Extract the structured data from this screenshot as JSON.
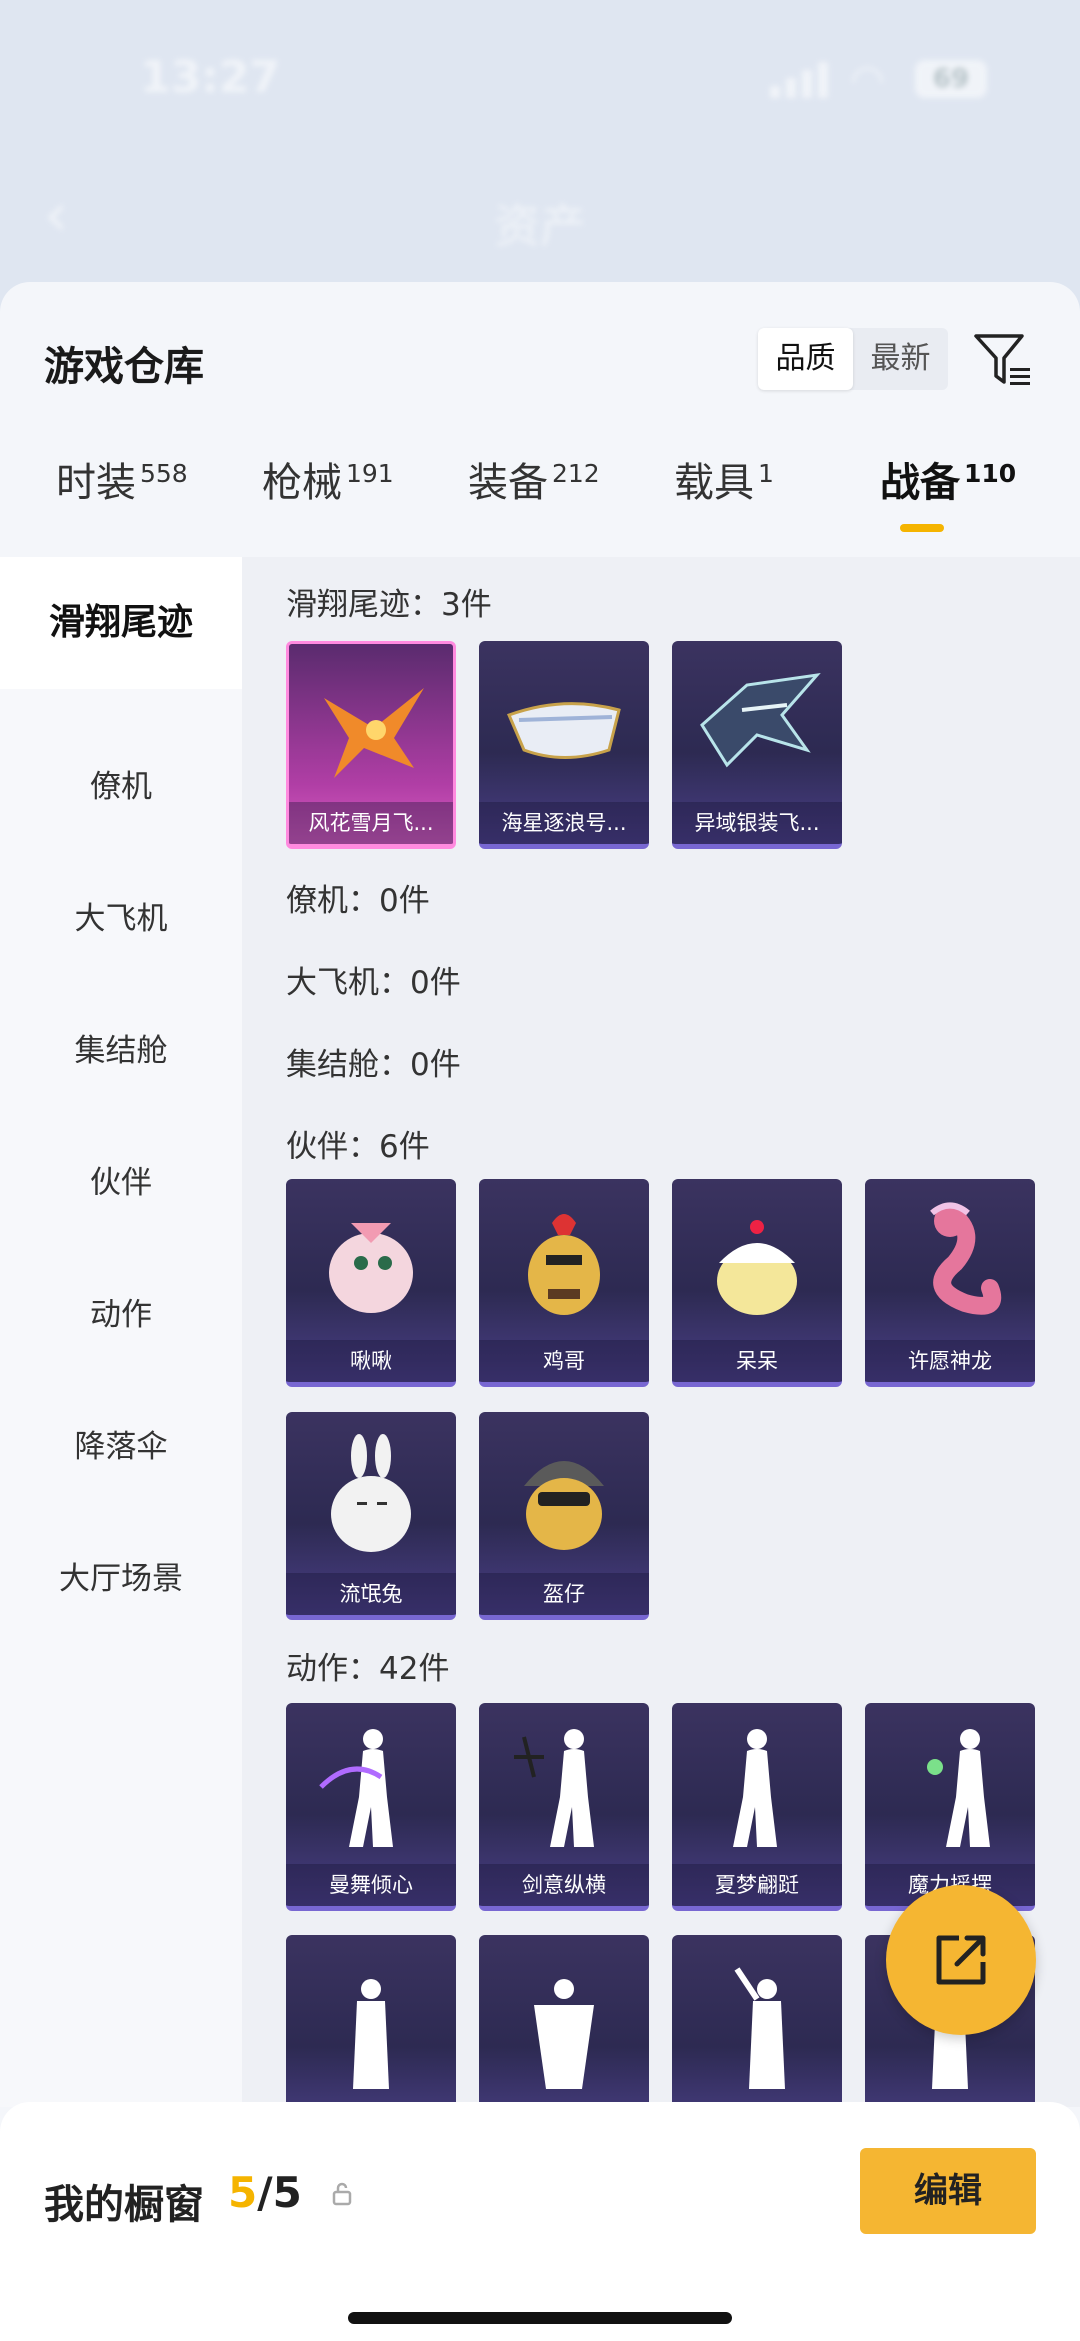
{
  "status_bar": {
    "time": "13:27",
    "battery": "69"
  },
  "nav": {
    "back_icon": "chevron-left-icon",
    "title": "资产"
  },
  "header": {
    "title": "游戏仓库",
    "sort_options": [
      "品质",
      "最新"
    ],
    "sort_selected": "品质"
  },
  "tabs": [
    {
      "label": "时装",
      "count": "558"
    },
    {
      "label": "枪械",
      "count": "191"
    },
    {
      "label": "装备",
      "count": "212"
    },
    {
      "label": "载具",
      "count": "1"
    },
    {
      "label": "战备",
      "count": "110",
      "active": true
    }
  ],
  "sidebar": [
    {
      "label": "滑翔尾迹",
      "active": true
    },
    {
      "label": "僚机"
    },
    {
      "label": "大飞机"
    },
    {
      "label": "集结舱"
    },
    {
      "label": "伙伴"
    },
    {
      "label": "动作"
    },
    {
      "label": "降落伞"
    },
    {
      "label": "大厅场景"
    }
  ],
  "sections": {
    "glide": {
      "title": "滑翔尾迹：3件",
      "items": [
        "风花雪月飞...",
        "海星逐浪号...",
        "异域银装飞..."
      ]
    },
    "wingman": {
      "title": "僚机：0件"
    },
    "plane": {
      "title": "大飞机：0件"
    },
    "pod": {
      "title": "集结舱：0件"
    },
    "partner": {
      "title": "伙伴：6件",
      "items": [
        "啾啾",
        "鸡哥",
        "呆呆",
        "许愿神龙",
        "流氓兔",
        "盔仔"
      ]
    },
    "action": {
      "title": "动作：42件",
      "items": [
        "曼舞倾心",
        "剑意纵横",
        "夏梦翩跹",
        "魔力摇摆",
        "",
        "",
        "",
        ""
      ]
    }
  },
  "bottom": {
    "label": "我的橱窗",
    "count_current": "5",
    "count_sep": "/5",
    "edit_label": "编辑"
  },
  "colors": {
    "accent": "#f5b632",
    "card": "#2d2a52",
    "legendary": "#c04bb0"
  }
}
